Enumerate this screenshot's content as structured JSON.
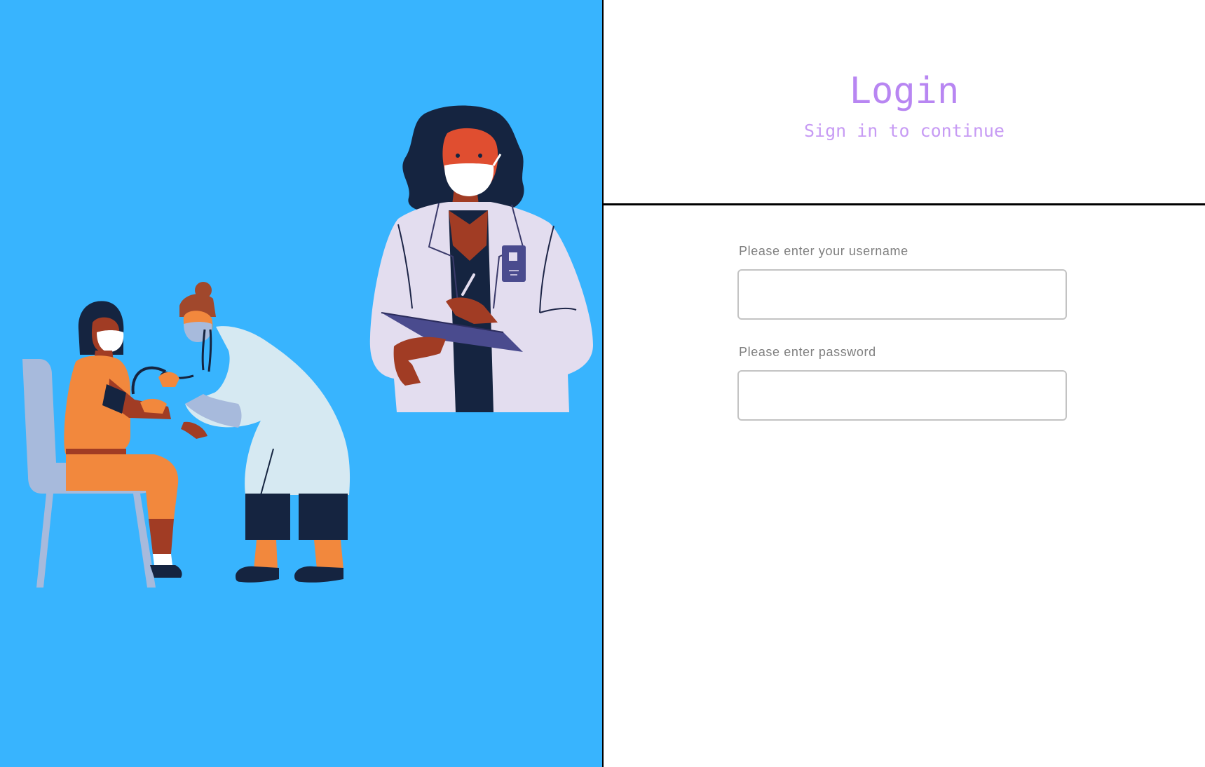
{
  "colors": {
    "left_panel_bg": "#38b4fe",
    "accent_purple": "#b886f2",
    "label_gray": "#7f7f7f",
    "input_border": "#c3c3c3"
  },
  "illustration": {
    "description_icon": "doctor-checkup-illustration"
  },
  "login": {
    "title": "Login",
    "subtitle": "Sign in to continue"
  },
  "form": {
    "username_label": "Please enter your username",
    "username_value": "",
    "password_label": "Please enter password",
    "password_value": ""
  }
}
